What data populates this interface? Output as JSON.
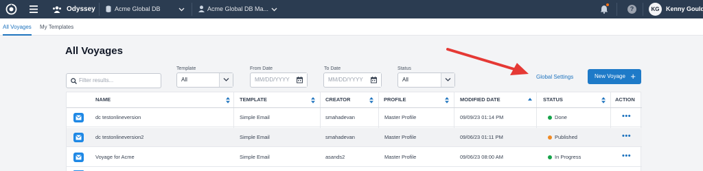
{
  "topbar": {
    "app_name": "Odyssey",
    "database": "Acme Global DB",
    "profile": "Acme Global DB Ma...",
    "user_initials": "KG",
    "user_name": "Kenny Gould",
    "help_symbol": "?"
  },
  "tabs": [
    {
      "label": "All Voyages",
      "active": true
    },
    {
      "label": "My Templates",
      "active": false
    }
  ],
  "page": {
    "title": "All Voyages"
  },
  "filters": {
    "search_placeholder": "Filter results...",
    "template_label": "Template",
    "template_value": "All",
    "from_date_label": "From Date",
    "from_date_placeholder": "MM/DD/YYYY",
    "to_date_label": "To Date",
    "to_date_placeholder": "MM/DD/YYYY",
    "status_label": "Status",
    "status_value": "All"
  },
  "actions": {
    "global_settings": "Global Settings",
    "new_voyage": "New Voyage",
    "new_voyage_symbol": "+"
  },
  "table": {
    "headers": {
      "name": "NAME",
      "template": "TEMPLATE",
      "creator": "CREATOR",
      "profile": "PROFILE",
      "modified": "MODIFIED DATE",
      "status": "STATUS",
      "action": "ACTION"
    },
    "rows": [
      {
        "name": "dc testonlineversion",
        "template": "Simple Email",
        "creator": "smahadevan",
        "profile": "Master Profile",
        "modified": "09/09/23 01:14 PM",
        "status": "Done",
        "status_color": "#16a34a",
        "action": "•••"
      },
      {
        "name": "dc testonlineversion2",
        "template": "Simple Email",
        "creator": "smahadevan",
        "profile": "Master Profile",
        "modified": "09/06/23 01:11 PM",
        "status": "Published",
        "status_color": "#f08a24",
        "action": "•••"
      },
      {
        "name": "Voyage for Acme",
        "template": "Simple Email",
        "creator": "asands2",
        "profile": "Master Profile",
        "modified": "09/06/23 08:00 AM",
        "status": "In Progress",
        "status_color": "#16a34a",
        "action": "•••"
      }
    ]
  },
  "colors": {
    "topbar": "#2b3c51",
    "accent": "#1e73be",
    "button": "#1e7ac8",
    "annotation_arrow": "#e53935"
  }
}
